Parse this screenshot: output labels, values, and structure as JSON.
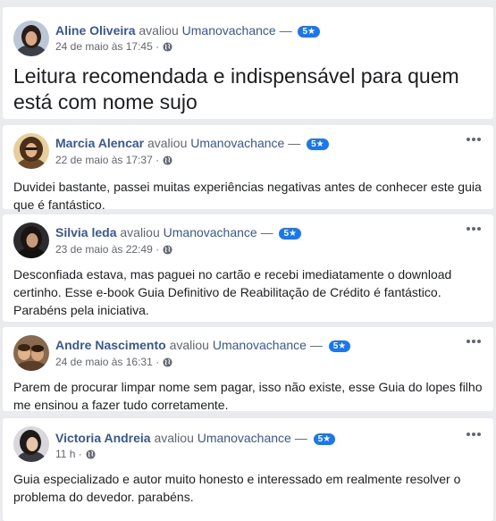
{
  "reviews": [
    {
      "name": "Aline Oliveira",
      "verb": "avaliou",
      "page": "Umanovachance",
      "rating": "5★",
      "date": "24 de maio às 17:45 ·",
      "text": "Leitura recomendada e indispensável para quem está com nome sujo"
    },
    {
      "name": "Marcia Alencar",
      "verb": "avaliou",
      "page": "Umanovachance",
      "rating": "5★",
      "date": "22 de maio às 17:37 ·",
      "text": "Duvidei bastante, passei muitas experiências negativas antes de conhecer este guia que é fantástico."
    },
    {
      "name": "Silvia leda",
      "verb": "avaliou",
      "page": "Umanovachance",
      "rating": "5★",
      "date": "23 de maio às 22:49 ·",
      "text": "Desconfiada estava, mas paguei no cartão e recebi imediatamente o download certinho. Esse e-book Guia Definitivo de Reabilitação de Crédito é fantástico. Parabéns pela iniciativa."
    },
    {
      "name": "Andre Nascimento",
      "verb": "avaliou",
      "page": "Umanovachance",
      "rating": "5★",
      "date": "24 de maio às 16:31 ·",
      "text": "Parem de procurar limpar nome sem pagar, isso não existe, esse Guia do lopes filho me ensinou a fazer tudo corretamente."
    },
    {
      "name": "Victoria Andreia",
      "verb": "avaliou",
      "page": "Umanovachance",
      "rating": "5★",
      "date": "11 h ·",
      "text": "Guia especializado e autor muito honesto e interessado em realmente resolver o problema do devedor. parabéns."
    }
  ],
  "icons": {
    "privacy": "globe-icon",
    "options": "more-options-icon"
  },
  "colors": {
    "name": "#365899",
    "badge": "#1877f2",
    "background": "#e9ebee"
  }
}
